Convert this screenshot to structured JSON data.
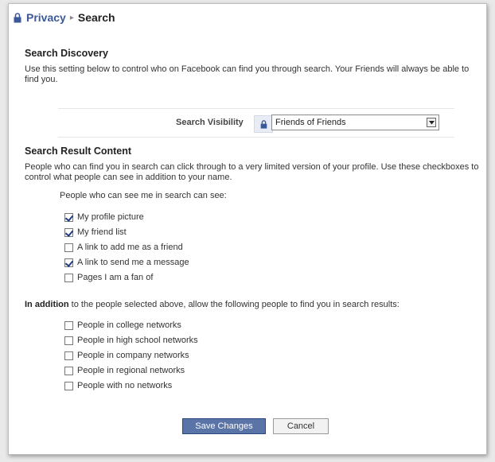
{
  "breadcrumb": {
    "parent": "Privacy",
    "separator": "▸",
    "current": "Search"
  },
  "discovery": {
    "title": "Search Discovery",
    "description": "Use this setting below to control who on Facebook can find you through search. Your Friends will always be able to find you.",
    "visibility_label": "Search Visibility",
    "visibility_value": "Friends of Friends"
  },
  "result_content": {
    "title": "Search Result Content",
    "description": "People who can find you in search can click through to a very limited version of your profile. Use these checkboxes to control what people can see in addition to your name.",
    "subheading": "People who can see me in search can see:",
    "options": [
      {
        "label": "My profile picture",
        "checked": true
      },
      {
        "label": "My friend list",
        "checked": true
      },
      {
        "label": "A link to add me as a friend",
        "checked": false
      },
      {
        "label": "A link to send me a message",
        "checked": true
      },
      {
        "label": "Pages I am a fan of",
        "checked": false
      }
    ]
  },
  "addition": {
    "lead": "In addition",
    "text": " to the people selected above, allow the following people to find you in search results:",
    "options": [
      {
        "label": "People in college networks",
        "checked": false
      },
      {
        "label": "People in high school networks",
        "checked": false
      },
      {
        "label": "People in company networks",
        "checked": false
      },
      {
        "label": "People in regional networks",
        "checked": false
      },
      {
        "label": "People with no networks",
        "checked": false
      }
    ]
  },
  "buttons": {
    "save": "Save Changes",
    "cancel": "Cancel"
  },
  "colors": {
    "brand": "#3b5998",
    "save_bg": "#5b74a8"
  }
}
